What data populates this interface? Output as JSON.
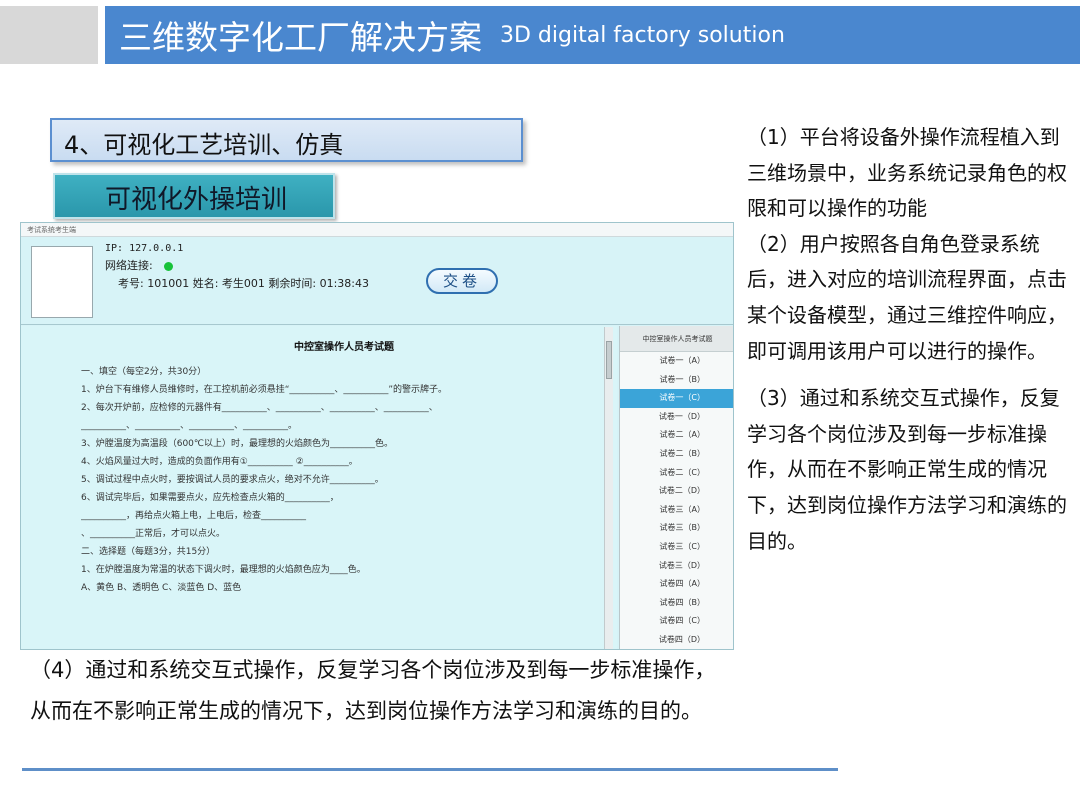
{
  "header": {
    "title": "三维数字化工厂解决方案",
    "subtitle": "3D digital factory solution"
  },
  "section": {
    "heading": "4、可视化工艺培训、仿真",
    "subheading": "可视化外操培训"
  },
  "screenshot": {
    "window_title": "考试系统考生端",
    "ip": "IP: 127.0.0.1",
    "network_label": "网络连接:",
    "network_status_color": "#18c23a",
    "exam_line": "考号: 101001   姓名: 考生001   剩余时间: 01:38:43",
    "submit_label": "交卷",
    "paper_title": "中控室操作人员考试题",
    "questions": [
      "一、填空（每空2分，共30分）",
      "1、炉台下有维修人员维修时，在工控机前必须悬挂“__________、__________”的警示牌子。",
      "2、每次开炉前，应检修的元器件有__________、__________、__________、__________、",
      "__________、__________、__________、__________。",
      "3、炉膛温度为高温段（600℃以上）时，最理想的火焰颜色为__________色。",
      "4、火焰风量过大时，造成的负面作用有①__________  ②__________。",
      "5、调试过程中点火时，要按调试人员的要求点火，绝对不允许__________。",
      "6、调试完毕后，如果需要点火，应先检查点火箱的__________，",
      "__________，再给点火箱上电，上电后，检查__________",
      "、__________正常后，才可以点火。",
      "二、选择题（每题3分，共15分）",
      "1、在炉膛温度为常温的状态下调火时，最理想的火焰颜色应为____色。",
      "A、黄色      B、透明色      C、淡蓝色      D、蓝色"
    ],
    "side_header": "中控室操作人员考试题",
    "side_items": [
      "试卷一（A）",
      "试卷一（B）",
      "试卷一（C）",
      "试卷一（D）",
      "试卷二（A）",
      "试卷二（B）",
      "试卷二（C）",
      "试卷二（D）",
      "试卷三（A）",
      "试卷三（B）",
      "试卷三（C）",
      "试卷三（D）",
      "试卷四（A）",
      "试卷四（B）",
      "试卷四（C）",
      "试卷四（D）"
    ],
    "selected_item": "试卷一（C）"
  },
  "caption": "（4）通过和系统交互式操作，反复学习各个岗位涉及到每一步标准操作，从而在不影响正常生成的情况下，达到岗位操作方法学习和演练的目的。",
  "right_column": {
    "p1": "（1）平台将设备外操作流程植入到三维场景中，业务系统记录角色的权限和可以操作的功能",
    "p2": "（2）用户按照各自角色登录系统后，进入对应的培训流程界面，点击某个设备模型，通过三维控件响应，即可调用该用户可以进行的操作。",
    "p3": "（3）通过和系统交互式操作，反复学习各个岗位涉及到每一步标准操作，从而在不影响正常生成的情况下，达到岗位操作方法学习和演练的目的。"
  },
  "colors": {
    "header_blue": "#4a87cf",
    "accent_teal": "#2a97ab",
    "selected_blue": "#3ba4d8"
  }
}
